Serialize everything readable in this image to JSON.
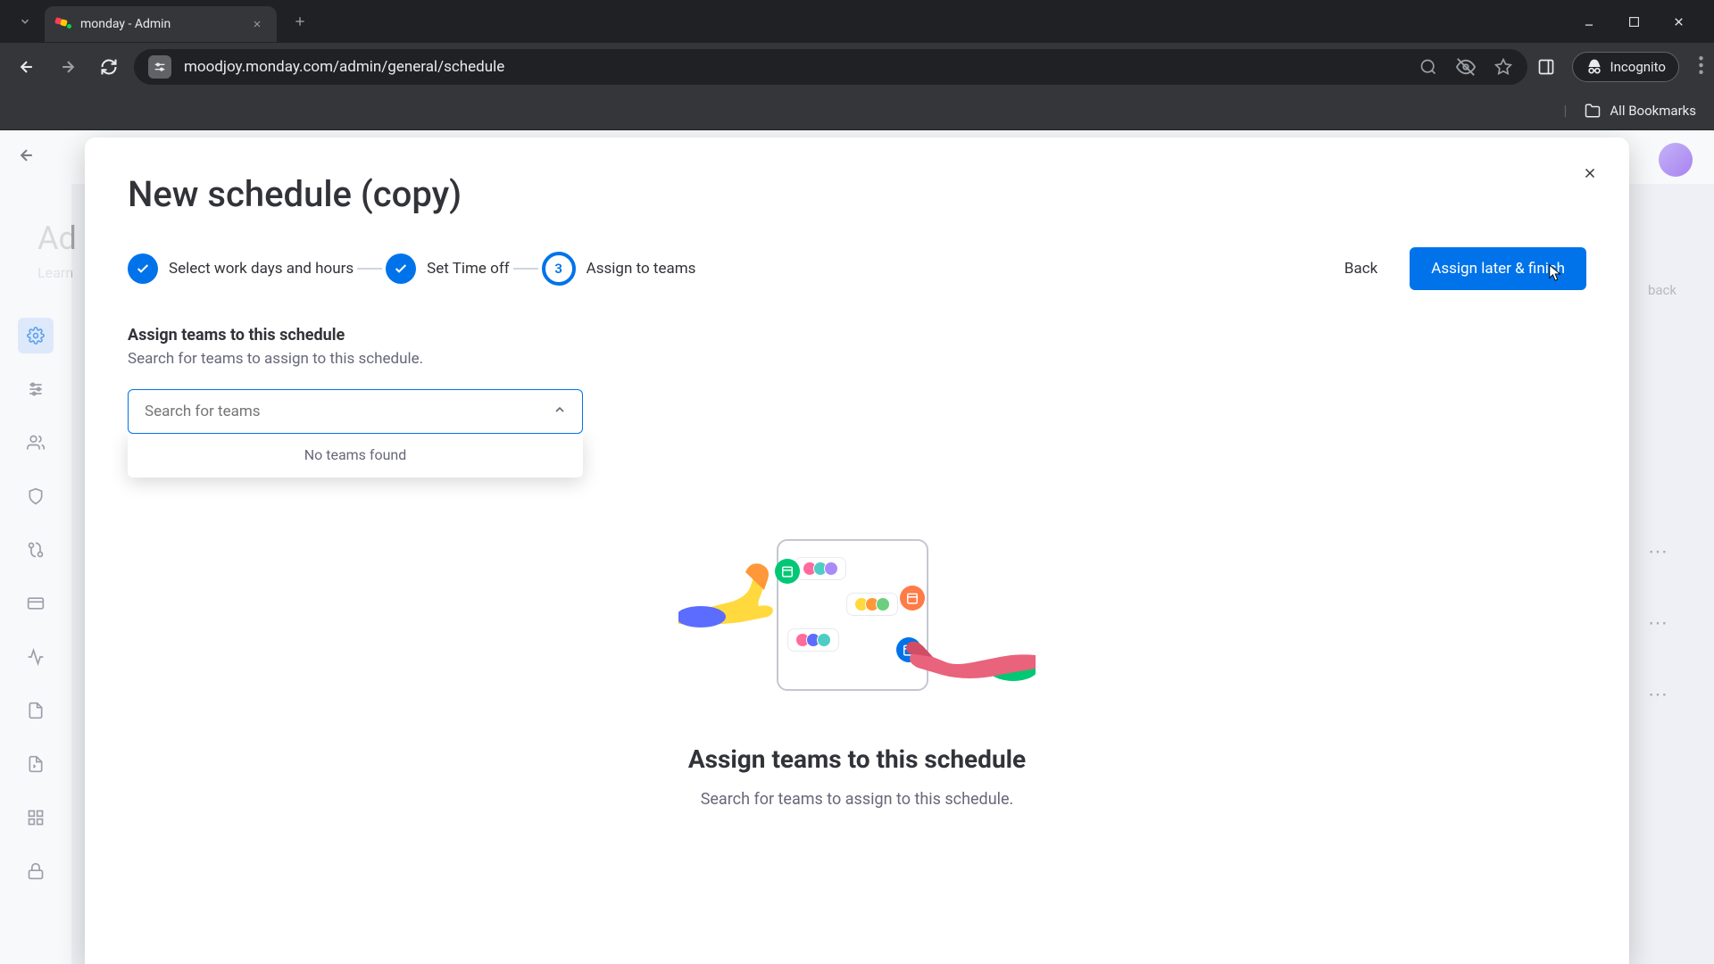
{
  "browser": {
    "tab_title": "monday - Admin",
    "url": "moodjoy.monday.com/admin/general/schedule",
    "incognito_label": "Incognito",
    "all_bookmarks": "All Bookmarks"
  },
  "backdrop": {
    "title": "Ad",
    "subtitle": "Learn",
    "feedback": "back"
  },
  "modal": {
    "title": "New schedule (copy)",
    "steps": [
      {
        "label": "Select work days and hours",
        "state": "done"
      },
      {
        "label": "Set Time off",
        "state": "done"
      },
      {
        "label": "Assign to teams",
        "state": "current",
        "num": "3"
      }
    ],
    "back_label": "Back",
    "primary_label": "Assign later & finish",
    "section_title": "Assign teams to this schedule",
    "section_subtitle": "Search for teams to assign to this schedule.",
    "search_placeholder": "Search for teams",
    "dropdown_empty": "No teams found",
    "empty_title": "Assign teams to this schedule",
    "empty_subtitle": "Search for teams to assign to this schedule."
  },
  "colors": {
    "primary": "#0073ea",
    "text": "#323338",
    "muted": "#676879"
  }
}
